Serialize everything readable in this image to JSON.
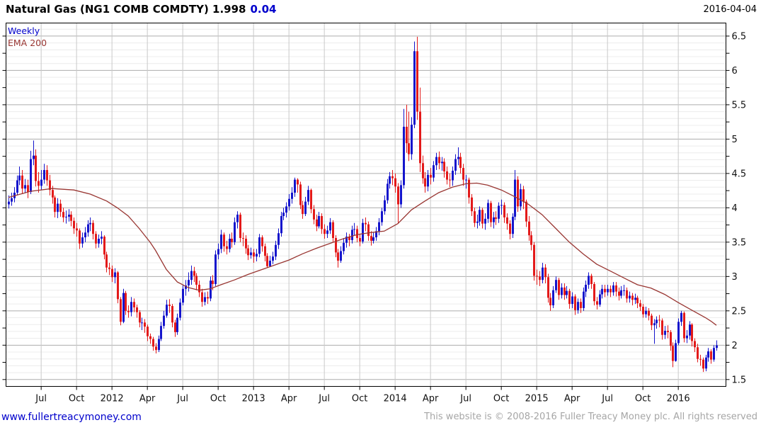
{
  "header": {
    "title": "Natural Gas (NG1 COMB COMDTY) 1.998",
    "change": "0.04",
    "date": "2016-04-04"
  },
  "legend": {
    "series": "Weekly",
    "overlay": "EMA 200"
  },
  "footer": {
    "site": "www.fullertreacymoney.com",
    "copyright": "This website is © 2008-2016 Fuller Treacy Money plc. All rights reserved"
  },
  "chart_data": {
    "type": "candlestick",
    "instrument": "Natural Gas (NG1 COMB COMDTY)",
    "timeframe": "Weekly",
    "overlay": "EMA 200",
    "last_price": 1.998,
    "change": 0.04,
    "ylim": [
      1.4,
      6.69
    ],
    "y_major_step": 0.5,
    "y_minor_step": 0.1,
    "y_tick_step": 0.25,
    "y_tick_labels": [
      "6.5",
      "6",
      "5.5",
      "5",
      "4.5",
      "4",
      "3.5",
      "3",
      "2.5",
      "2",
      "1.5"
    ],
    "x_labels": [
      {
        "label": "Jul",
        "week": 12
      },
      {
        "label": "Oct",
        "week": 25
      },
      {
        "label": "2012",
        "week": 38
      },
      {
        "label": "Apr",
        "week": 51
      },
      {
        "label": "Jul",
        "week": 64
      },
      {
        "label": "Oct",
        "week": 77
      },
      {
        "label": "2013",
        "week": 90
      },
      {
        "label": "Apr",
        "week": 103
      },
      {
        "label": "Jul",
        "week": 116
      },
      {
        "label": "Oct",
        "week": 129
      },
      {
        "label": "2014",
        "week": 142
      },
      {
        "label": "Apr",
        "week": 155
      },
      {
        "label": "Jul",
        "week": 168
      },
      {
        "label": "Oct",
        "week": 181
      },
      {
        "label": "2015",
        "week": 194
      },
      {
        "label": "Apr",
        "week": 207
      },
      {
        "label": "Jul",
        "week": 220
      },
      {
        "label": "Oct",
        "week": 233
      },
      {
        "label": "2016",
        "week": 246
      }
    ],
    "colors": {
      "up": "#1515cc",
      "down": "#e31a1a",
      "ema": "#993632",
      "grid_minor": "#ececec",
      "grid_major": "#adadad",
      "grid_vert": "#c9c9c9",
      "axis": "#000000",
      "label": "#111111"
    },
    "first_open": 4.05,
    "candles": [
      [
        4.09,
        4.18,
        3.99
      ],
      [
        4.14,
        4.22,
        4.03
      ],
      [
        4.22,
        4.3,
        4.08
      ],
      [
        4.4,
        4.47,
        4.18
      ],
      [
        4.47,
        4.6,
        4.33
      ],
      [
        4.28,
        4.55,
        4.2
      ],
      [
        4.33,
        4.42,
        4.22
      ],
      [
        4.23,
        4.41,
        4.14
      ],
      [
        4.71,
        4.83,
        4.2
      ],
      [
        4.76,
        4.98,
        4.62
      ],
      [
        4.39,
        4.85,
        4.31
      ],
      [
        4.32,
        4.52,
        4.22
      ],
      [
        4.41,
        4.55,
        4.26
      ],
      [
        4.55,
        4.64,
        4.35
      ],
      [
        4.4,
        4.62,
        4.32
      ],
      [
        4.26,
        4.48,
        4.18
      ],
      [
        4.15,
        4.32,
        4.06
      ],
      [
        3.94,
        4.18,
        3.86
      ],
      [
        4.06,
        4.14,
        3.85
      ],
      [
        3.94,
        4.12,
        3.87
      ],
      [
        3.86,
        4.0,
        3.79
      ],
      [
        3.87,
        3.96,
        3.77
      ],
      [
        3.9,
        3.98,
        3.8
      ],
      [
        3.81,
        3.95,
        3.73
      ],
      [
        3.7,
        3.86,
        3.62
      ],
      [
        3.67,
        3.78,
        3.58
      ],
      [
        3.48,
        3.7,
        3.4
      ],
      [
        3.57,
        3.64,
        3.42
      ],
      [
        3.64,
        3.72,
        3.5
      ],
      [
        3.76,
        3.82,
        3.58
      ],
      [
        3.78,
        3.86,
        3.66
      ],
      [
        3.62,
        3.82,
        3.54
      ],
      [
        3.48,
        3.66,
        3.41
      ],
      [
        3.55,
        3.61,
        3.42
      ],
      [
        3.58,
        3.66,
        3.47
      ],
      [
        3.32,
        3.6,
        3.25
      ],
      [
        3.13,
        3.36,
        3.06
      ],
      [
        3.11,
        3.2,
        3.02
      ],
      [
        2.99,
        3.16,
        2.92
      ],
      [
        3.06,
        3.12,
        2.9
      ],
      [
        2.67,
        3.08,
        2.61
      ],
      [
        2.34,
        2.7,
        2.29
      ],
      [
        2.76,
        2.82,
        2.32
      ],
      [
        2.5,
        2.79,
        2.44
      ],
      [
        2.48,
        2.58,
        2.4
      ],
      [
        2.63,
        2.7,
        2.42
      ],
      [
        2.55,
        2.68,
        2.48
      ],
      [
        2.48,
        2.59,
        2.4
      ],
      [
        2.33,
        2.51,
        2.26
      ],
      [
        2.33,
        2.4,
        2.22
      ],
      [
        2.27,
        2.38,
        2.18
      ],
      [
        2.13,
        2.3,
        2.06
      ],
      [
        2.09,
        2.17,
        2.02
      ],
      [
        1.98,
        2.12,
        1.92
      ],
      [
        1.93,
        2.03,
        1.88
      ],
      [
        2.09,
        2.14,
        1.9
      ],
      [
        2.28,
        2.34,
        2.06
      ],
      [
        2.43,
        2.5,
        2.24
      ],
      [
        2.59,
        2.66,
        2.4
      ],
      [
        2.57,
        2.67,
        2.47
      ],
      [
        2.33,
        2.6,
        2.26
      ],
      [
        2.19,
        2.37,
        2.12
      ],
      [
        2.4,
        2.46,
        2.15
      ],
      [
        2.62,
        2.68,
        2.36
      ],
      [
        2.82,
        2.88,
        2.58
      ],
      [
        2.87,
        2.95,
        2.72
      ],
      [
        2.95,
        3.06,
        2.78
      ],
      [
        3.08,
        3.16,
        2.88
      ],
      [
        3.01,
        3.14,
        2.92
      ],
      [
        2.88,
        3.05,
        2.8
      ],
      [
        2.77,
        2.94,
        2.7
      ],
      [
        2.63,
        2.82,
        2.56
      ],
      [
        2.7,
        2.77,
        2.58
      ],
      [
        2.68,
        2.78,
        2.6
      ],
      [
        2.94,
        3.0,
        2.64
      ],
      [
        2.89,
        3.02,
        2.8
      ],
      [
        3.32,
        3.38,
        2.86
      ],
      [
        3.4,
        3.48,
        3.25
      ],
      [
        3.61,
        3.68,
        3.34
      ],
      [
        3.44,
        3.64,
        3.36
      ],
      [
        3.4,
        3.52,
        3.32
      ],
      [
        3.55,
        3.62,
        3.35
      ],
      [
        3.5,
        3.64,
        3.42
      ],
      [
        3.79,
        3.86,
        3.46
      ],
      [
        3.9,
        3.95,
        3.7
      ],
      [
        3.56,
        3.93,
        3.5
      ],
      [
        3.55,
        3.64,
        3.44
      ],
      [
        3.41,
        3.6,
        3.33
      ],
      [
        3.31,
        3.46,
        3.24
      ],
      [
        3.35,
        3.42,
        3.26
      ],
      [
        3.29,
        3.4,
        3.2
      ],
      [
        3.33,
        3.4,
        3.22
      ],
      [
        3.57,
        3.62,
        3.28
      ],
      [
        3.44,
        3.6,
        3.36
      ],
      [
        3.3,
        3.48,
        3.22
      ],
      [
        3.15,
        3.34,
        3.13
      ],
      [
        3.23,
        3.3,
        3.14
      ],
      [
        3.29,
        3.36,
        3.18
      ],
      [
        3.46,
        3.52,
        3.24
      ],
      [
        3.63,
        3.7,
        3.4
      ],
      [
        3.88,
        3.94,
        3.58
      ],
      [
        3.93,
        4.0,
        3.82
      ],
      [
        4.02,
        4.08,
        3.86
      ],
      [
        4.13,
        4.2,
        3.96
      ],
      [
        4.22,
        4.3,
        4.06
      ],
      [
        4.41,
        4.44,
        4.16
      ],
      [
        4.34,
        4.43,
        4.22
      ],
      [
        4.04,
        4.38,
        3.98
      ],
      [
        3.91,
        4.1,
        3.84
      ],
      [
        4.09,
        4.16,
        3.88
      ],
      [
        4.26,
        4.32,
        4.04
      ],
      [
        3.98,
        4.28,
        3.92
      ],
      [
        3.83,
        4.04,
        3.76
      ],
      [
        3.73,
        3.9,
        3.66
      ],
      [
        3.88,
        3.94,
        3.7
      ],
      [
        3.69,
        3.92,
        3.62
      ],
      [
        3.62,
        3.76,
        3.55
      ],
      [
        3.67,
        3.74,
        3.56
      ],
      [
        3.79,
        3.85,
        3.62
      ],
      [
        3.56,
        3.82,
        3.5
      ],
      [
        3.35,
        3.6,
        3.28
      ],
      [
        3.23,
        3.4,
        3.13
      ],
      [
        3.37,
        3.44,
        3.2
      ],
      [
        3.49,
        3.56,
        3.32
      ],
      [
        3.58,
        3.64,
        3.42
      ],
      [
        3.53,
        3.62,
        3.44
      ],
      [
        3.68,
        3.74,
        3.48
      ],
      [
        3.69,
        3.78,
        3.6
      ],
      [
        3.56,
        3.74,
        3.5
      ],
      [
        3.51,
        3.62,
        3.44
      ],
      [
        3.78,
        3.84,
        3.48
      ],
      [
        3.76,
        3.86,
        3.66
      ],
      [
        3.59,
        3.8,
        3.52
      ],
      [
        3.52,
        3.66,
        3.45
      ],
      [
        3.57,
        3.64,
        3.48
      ],
      [
        3.66,
        3.72,
        3.52
      ],
      [
        3.79,
        3.85,
        3.6
      ],
      [
        3.95,
        4.0,
        3.74
      ],
      [
        4.11,
        4.18,
        3.9
      ],
      [
        4.35,
        4.42,
        4.06
      ],
      [
        4.46,
        4.52,
        4.28
      ],
      [
        4.43,
        4.55,
        4.33
      ],
      [
        4.31,
        4.5,
        4.22
      ],
      [
        4.05,
        4.36,
        3.78
      ],
      [
        4.33,
        4.4,
        4.0
      ],
      [
        5.18,
        5.44,
        4.28
      ],
      [
        4.94,
        5.5,
        4.8
      ],
      [
        4.78,
        5.4,
        4.68
      ],
      [
        5.21,
        5.32,
        4.7
      ],
      [
        6.28,
        6.42,
        5.16
      ],
      [
        5.4,
        6.49,
        5.28
      ],
      [
        4.65,
        5.75,
        4.52
      ],
      [
        4.43,
        4.76,
        4.35
      ],
      [
        4.31,
        4.52,
        4.22
      ],
      [
        4.48,
        4.55,
        4.24
      ],
      [
        4.44,
        4.58,
        4.34
      ],
      [
        4.62,
        4.68,
        4.38
      ],
      [
        4.74,
        4.8,
        4.55
      ],
      [
        4.65,
        4.82,
        4.56
      ],
      [
        4.67,
        4.74,
        4.54
      ],
      [
        4.53,
        4.72,
        4.44
      ],
      [
        4.41,
        4.6,
        4.34
      ],
      [
        4.4,
        4.5,
        4.3
      ],
      [
        4.54,
        4.6,
        4.32
      ],
      [
        4.71,
        4.78,
        4.48
      ],
      [
        4.74,
        4.88,
        4.62
      ],
      [
        4.58,
        4.8,
        4.5
      ],
      [
        4.41,
        4.64,
        4.32
      ],
      [
        4.41,
        4.48,
        4.28
      ],
      [
        4.15,
        4.44,
        4.06
      ],
      [
        3.95,
        4.2,
        3.88
      ],
      [
        3.78,
        4.0,
        3.72
      ],
      [
        3.8,
        3.9,
        3.7
      ],
      [
        3.97,
        4.02,
        3.74
      ],
      [
        3.77,
        4.0,
        3.7
      ],
      [
        3.84,
        3.92,
        3.68
      ],
      [
        4.07,
        4.12,
        3.78
      ],
      [
        3.79,
        4.1,
        3.72
      ],
      [
        3.86,
        3.94,
        3.7
      ],
      [
        3.84,
        3.95,
        3.75
      ],
      [
        4.03,
        4.08,
        3.78
      ],
      [
        4.04,
        4.12,
        3.9
      ],
      [
        3.86,
        4.08,
        3.78
      ],
      [
        3.77,
        3.92,
        3.68
      ],
      [
        3.62,
        3.82,
        3.54
      ],
      [
        3.87,
        3.92,
        3.56
      ],
      [
        4.41,
        4.55,
        3.82
      ],
      [
        4.02,
        4.46,
        3.94
      ],
      [
        4.27,
        4.35,
        3.96
      ],
      [
        4.09,
        4.32,
        3.98
      ],
      [
        3.8,
        4.12,
        3.72
      ],
      [
        3.6,
        3.88,
        3.52
      ],
      [
        3.46,
        3.66,
        3.38
      ],
      [
        3.01,
        3.5,
        2.94
      ],
      [
        3.0,
        3.1,
        2.88
      ],
      [
        2.95,
        3.08,
        2.86
      ],
      [
        3.13,
        3.2,
        2.9
      ],
      [
        2.99,
        3.18,
        2.9
      ],
      [
        2.69,
        3.04,
        2.62
      ],
      [
        2.58,
        2.76,
        2.5
      ],
      [
        2.8,
        2.86,
        2.54
      ],
      [
        2.95,
        3.0,
        2.76
      ],
      [
        2.73,
        2.98,
        2.66
      ],
      [
        2.84,
        2.9,
        2.68
      ],
      [
        2.73,
        2.9,
        2.66
      ],
      [
        2.79,
        2.86,
        2.68
      ],
      [
        2.6,
        2.82,
        2.53
      ],
      [
        2.71,
        2.77,
        2.54
      ],
      [
        2.51,
        2.74,
        2.44
      ],
      [
        2.63,
        2.68,
        2.46
      ],
      [
        2.54,
        2.68,
        2.47
      ],
      [
        2.78,
        2.84,
        2.5
      ],
      [
        2.88,
        2.94,
        2.7
      ],
      [
        3.01,
        3.06,
        2.82
      ],
      [
        2.89,
        3.04,
        2.82
      ],
      [
        2.64,
        2.92,
        2.58
      ],
      [
        2.59,
        2.7,
        2.52
      ],
      [
        2.74,
        2.8,
        2.56
      ],
      [
        2.82,
        2.88,
        2.68
      ],
      [
        2.77,
        2.88,
        2.7
      ],
      [
        2.82,
        2.88,
        2.72
      ],
      [
        2.77,
        2.87,
        2.7
      ],
      [
        2.87,
        2.92,
        2.72
      ],
      [
        2.78,
        2.92,
        2.71
      ],
      [
        2.72,
        2.84,
        2.65
      ],
      [
        2.8,
        2.86,
        2.68
      ],
      [
        2.8,
        2.88,
        2.72
      ],
      [
        2.68,
        2.84,
        2.62
      ],
      [
        2.72,
        2.78,
        2.62
      ],
      [
        2.66,
        2.76,
        2.58
      ],
      [
        2.69,
        2.75,
        2.6
      ],
      [
        2.61,
        2.72,
        2.54
      ],
      [
        2.56,
        2.66,
        2.5
      ],
      [
        2.45,
        2.6,
        2.4
      ],
      [
        2.5,
        2.56,
        2.4
      ],
      [
        2.43,
        2.54,
        2.36
      ],
      [
        2.29,
        2.46,
        2.22
      ],
      [
        2.32,
        2.38,
        2.02
      ],
      [
        2.37,
        2.42,
        2.24
      ],
      [
        2.36,
        2.44,
        2.26
      ],
      [
        2.15,
        2.39,
        2.08
      ],
      [
        2.21,
        2.28,
        2.09
      ],
      [
        2.19,
        2.29,
        2.1
      ],
      [
        1.99,
        2.22,
        1.92
      ],
      [
        1.77,
        2.04,
        1.68
      ],
      [
        2.03,
        2.08,
        1.76
      ],
      [
        2.34,
        2.39,
        2.0
      ],
      [
        2.47,
        2.5,
        2.28
      ],
      [
        2.1,
        2.49,
        2.04
      ],
      [
        2.14,
        2.22,
        2.03
      ],
      [
        2.3,
        2.35,
        2.08
      ],
      [
        2.06,
        2.32,
        1.98
      ],
      [
        1.97,
        2.1,
        1.9
      ],
      [
        1.8,
        2.02,
        1.75
      ],
      [
        1.79,
        1.86,
        1.7
      ],
      [
        1.66,
        1.82,
        1.61
      ],
      [
        1.82,
        1.86,
        1.62
      ],
      [
        1.91,
        1.96,
        1.76
      ],
      [
        1.79,
        1.94,
        1.73
      ],
      [
        1.96,
        2.0,
        1.76
      ],
      [
        1.998,
        2.07,
        1.92
      ]
    ],
    "ema": [
      [
        0,
        4.15
      ],
      [
        8,
        4.24
      ],
      [
        16,
        4.28
      ],
      [
        24,
        4.26
      ],
      [
        30,
        4.2
      ],
      [
        36,
        4.1
      ],
      [
        40,
        4.0
      ],
      [
        44,
        3.88
      ],
      [
        48,
        3.7
      ],
      [
        52,
        3.5
      ],
      [
        54,
        3.38
      ],
      [
        58,
        3.1
      ],
      [
        62,
        2.92
      ],
      [
        66,
        2.84
      ],
      [
        70,
        2.8
      ],
      [
        74,
        2.82
      ],
      [
        78,
        2.88
      ],
      [
        83,
        2.95
      ],
      [
        88,
        3.03
      ],
      [
        93,
        3.1
      ],
      [
        98,
        3.17
      ],
      [
        103,
        3.24
      ],
      [
        108,
        3.33
      ],
      [
        113,
        3.41
      ],
      [
        118,
        3.48
      ],
      [
        123,
        3.55
      ],
      [
        128,
        3.61
      ],
      [
        133,
        3.64
      ],
      [
        138,
        3.66
      ],
      [
        143,
        3.77
      ],
      [
        148,
        3.97
      ],
      [
        153,
        4.1
      ],
      [
        158,
        4.22
      ],
      [
        163,
        4.3
      ],
      [
        168,
        4.35
      ],
      [
        172,
        4.36
      ],
      [
        176,
        4.33
      ],
      [
        181,
        4.26
      ],
      [
        186,
        4.16
      ],
      [
        191,
        4.05
      ],
      [
        196,
        3.9
      ],
      [
        201,
        3.7
      ],
      [
        206,
        3.5
      ],
      [
        211,
        3.33
      ],
      [
        216,
        3.18
      ],
      [
        221,
        3.08
      ],
      [
        226,
        2.98
      ],
      [
        231,
        2.88
      ],
      [
        236,
        2.83
      ],
      [
        241,
        2.74
      ],
      [
        246,
        2.62
      ],
      [
        251,
        2.51
      ],
      [
        256,
        2.4
      ],
      [
        258,
        2.35
      ],
      [
        260,
        2.29
      ]
    ]
  }
}
